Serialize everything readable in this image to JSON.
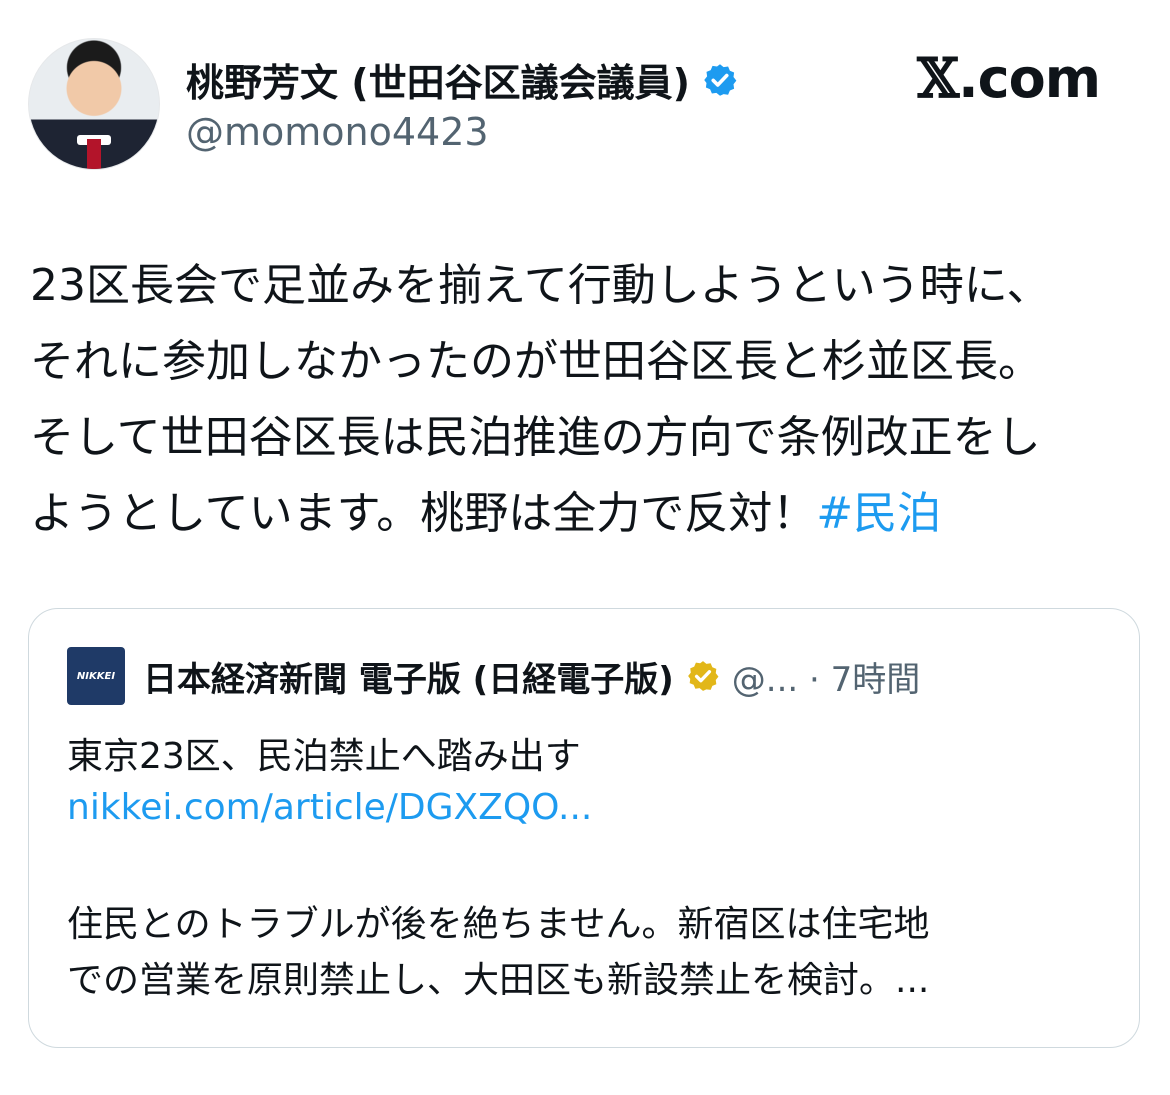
{
  "author": {
    "display_name": "桃野芳文 (世田谷区議会議員)",
    "handle": "@momono4423"
  },
  "brand": {
    "x_glyph": "𝕏",
    "suffix": ".com"
  },
  "tweet": {
    "lines": [
      "23区長会で足並みを揃えて行動しようという時に、",
      "それに参加しなかったのが世田谷区長と杉並区長。",
      "そして世田谷区長は民泊推進の方向で条例改正をし",
      "ようとしています。桃野は全力で反対！"
    ],
    "hashtag": "#民泊"
  },
  "quote": {
    "logo_text": "NIKKEI",
    "name": "日本経済新聞 電子版 (日経電子版)",
    "handle_time": "@... · 7時間",
    "headline": "東京23区、民泊禁止へ踏み出す",
    "link": "nikkei.com/article/DGXZQO...",
    "body_lines": [
      "住民とのトラブルが後を絶ちません。新宿区は住宅地",
      "での営業を原則禁止し、大田区も新設禁止を検討。..."
    ]
  },
  "colors": {
    "text": "#0f1419",
    "secondary": "#536471",
    "link": "#1d9bf0",
    "verified_blue": "#1d9bf0",
    "verified_gold": "#e2b719",
    "border": "#cfd9de",
    "nikkei_blue": "#1f3a67"
  }
}
